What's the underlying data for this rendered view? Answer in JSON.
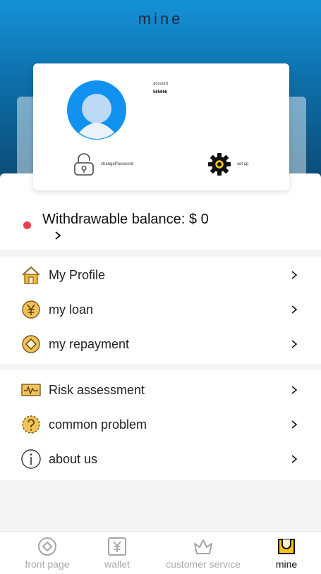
{
  "header": {
    "title": "mine"
  },
  "profile": {
    "account_label": "account",
    "account_value": "565666",
    "change_password_label": "changePassword",
    "setup_label": "set up"
  },
  "balance": {
    "text": "Withdrawable balance: $ 0"
  },
  "menu_group_1": [
    {
      "label": "My Profile",
      "icon": "house-icon"
    },
    {
      "label": "my loan",
      "icon": "yen-coin-icon"
    },
    {
      "label": "my repayment",
      "icon": "coin-icon"
    }
  ],
  "menu_group_2": [
    {
      "label": "Risk assessment",
      "icon": "chart-card-icon"
    },
    {
      "label": "common problem",
      "icon": "question-icon"
    },
    {
      "label": "about us",
      "icon": "info-icon"
    }
  ],
  "tabbar": [
    {
      "label": "front page",
      "icon": "compass-icon",
      "active": false
    },
    {
      "label": "wallet",
      "icon": "yen-wallet-icon",
      "active": false
    },
    {
      "label": "customer service",
      "icon": "crown-icon",
      "active": false
    },
    {
      "label": "mine",
      "icon": "user-card-icon",
      "active": true
    }
  ],
  "colors": {
    "accent": "#0f8fe0",
    "icon_gold": "#f2b83a",
    "badge_red": "#e8404e"
  }
}
